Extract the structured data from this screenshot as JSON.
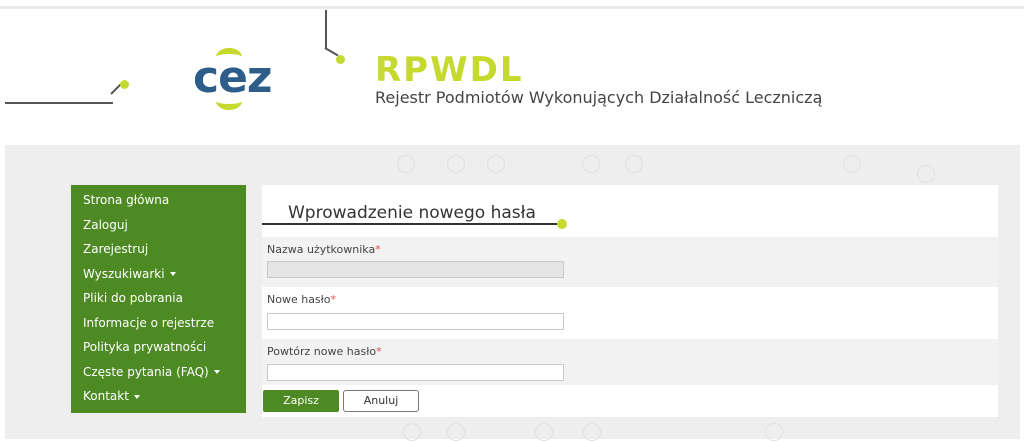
{
  "brand": {
    "logo_text": "cez",
    "title": "RPWDL",
    "subtitle": "Rejestr Podmiotów Wykonujących Działalność Leczniczą"
  },
  "sidebar": {
    "items": [
      {
        "label": "Strona główna",
        "has_dropdown": false
      },
      {
        "label": "Zaloguj",
        "has_dropdown": false
      },
      {
        "label": "Zarejestruj",
        "has_dropdown": false
      },
      {
        "label": "Wyszukiwarki",
        "has_dropdown": true
      },
      {
        "label": "Pliki do pobrania",
        "has_dropdown": false
      },
      {
        "label": "Informacje o rejestrze",
        "has_dropdown": false
      },
      {
        "label": "Polityka prywatności",
        "has_dropdown": false
      },
      {
        "label": "Częste pytania (FAQ)",
        "has_dropdown": true
      },
      {
        "label": "Kontakt",
        "has_dropdown": true
      }
    ]
  },
  "form": {
    "title": "Wprowadzenie nowego hasła",
    "required_mark": "*",
    "username": {
      "label": "Nazwa użytkownika",
      "value": ""
    },
    "new_password": {
      "label": "Nowe hasło",
      "value": ""
    },
    "repeat_password": {
      "label": "Powtórz nowe hasło",
      "value": ""
    },
    "save_label": "Zapisz",
    "cancel_label": "Anuluj"
  },
  "colors": {
    "accent_green": "#4e8a23",
    "lime": "#c5d92e",
    "logo_blue": "#2f5d8a"
  }
}
